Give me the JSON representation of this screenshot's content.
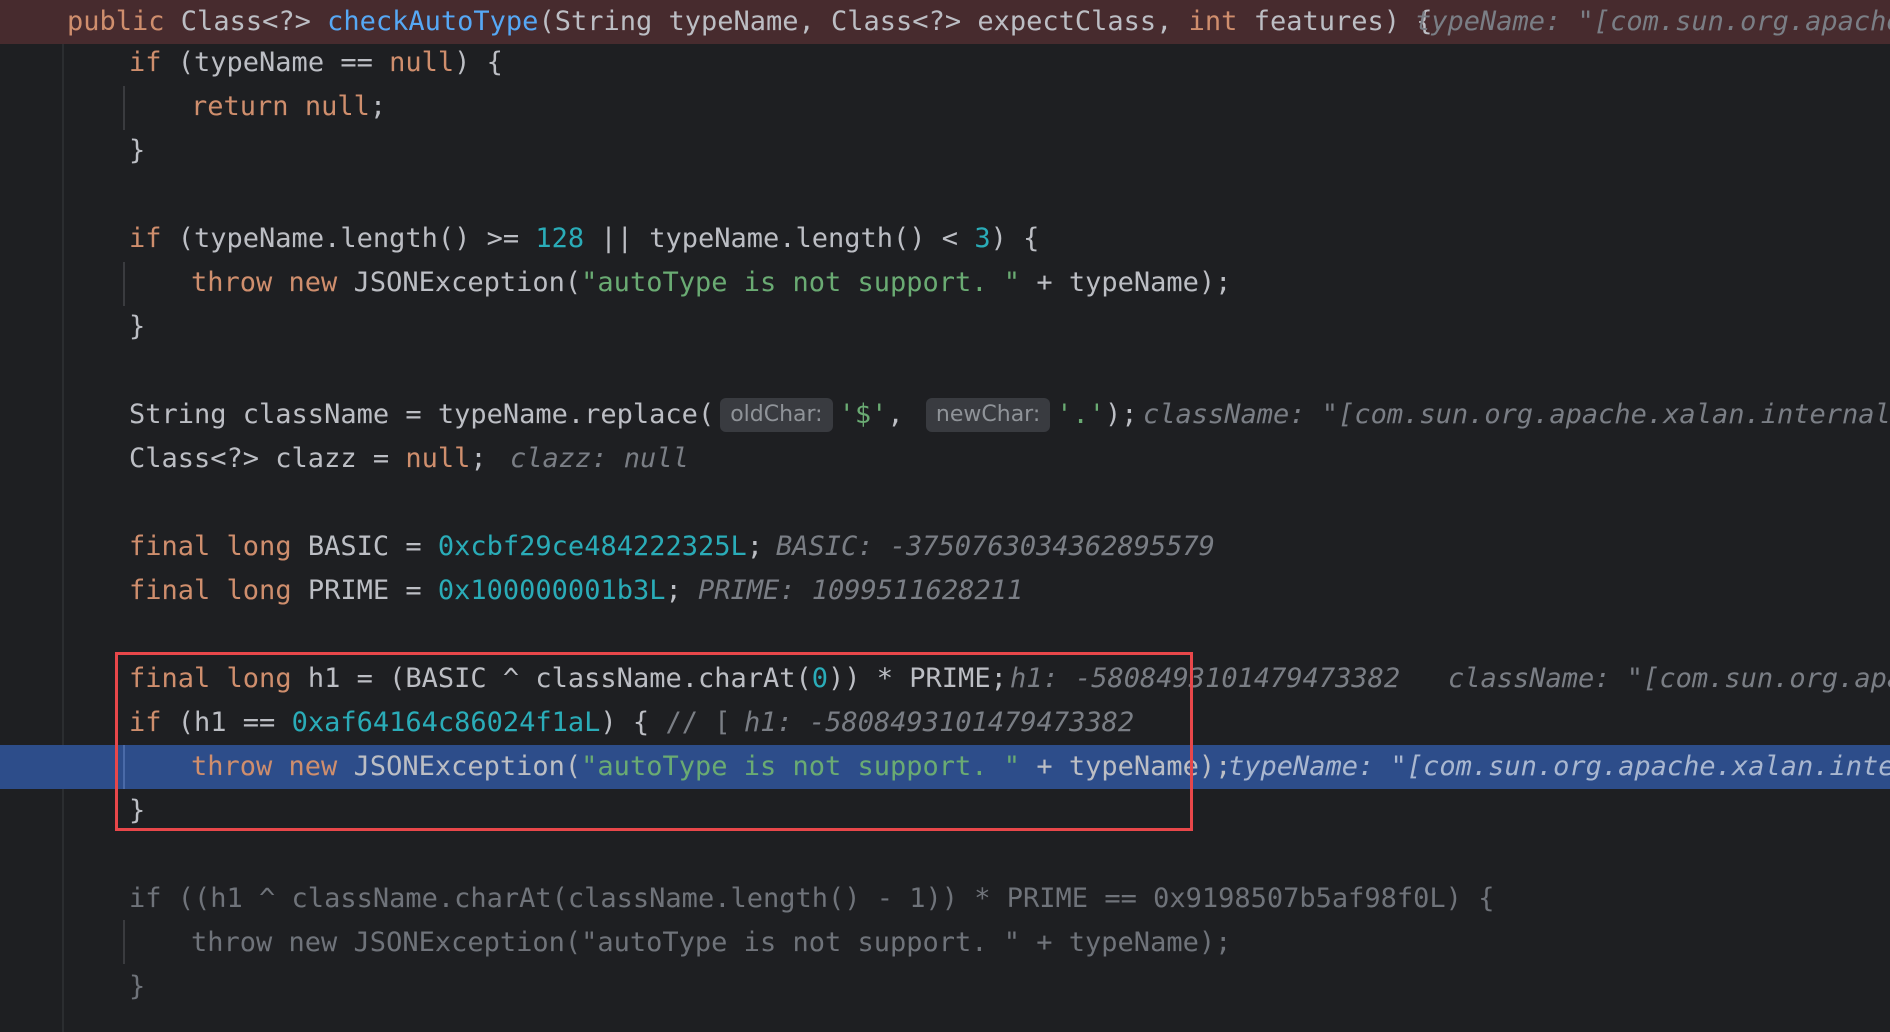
{
  "colors": {
    "background": "#1e1f22",
    "execution_line": "#472b2e",
    "current_line": "#2d4d8a",
    "annotation_box": "#e8474a",
    "keyword": "#cf8e6d",
    "function": "#56a8f5",
    "number": "#2aacb8",
    "string": "#6aab73"
  },
  "code": {
    "l1": {
      "kw1": "public",
      "t1": " Class<?> ",
      "fn": "checkAutoType",
      "t2": "(String typeName, Class<?> expectClass, ",
      "kw2": "int",
      "t3": " features) {",
      "hint": "typeName: \"[com.sun.org.apache"
    },
    "l2": {
      "kw1": "if",
      "t1": " (typeName == ",
      "kw2": "null",
      "t2": ") {"
    },
    "l3": {
      "kw1": "return",
      "t1": " ",
      "kw2": "null",
      "t2": ";"
    },
    "l4": {
      "t1": "}"
    },
    "l5": {
      "kw1": "if",
      "t1": " (typeName.length() >= ",
      "n1": "128",
      "t2": " || typeName.length() < ",
      "n2": "3",
      "t3": ") {"
    },
    "l6": {
      "kw1": "throw",
      "t1": " ",
      "kw2": "new",
      "t2": " JSONException(",
      "s1": "\"autoType is not support. \"",
      "t3": " + typeName);"
    },
    "l7": {
      "t1": "}"
    },
    "l8": {
      "t1": "String className = typeName.replace(",
      "ph1": "oldChar:",
      "s1": "'$'",
      "t2": ",",
      "ph2": "newChar:",
      "s2": "'.'",
      "t3": ");",
      "hint": "className: \"[com.sun.org.apache.xalan.internal.x"
    },
    "l9": {
      "t1": "Class<?> clazz = ",
      "kw1": "null",
      "t2": ";",
      "hint": "clazz: null"
    },
    "l10": {
      "kw1": "final",
      "t1": " ",
      "kw2": "long",
      "t2": " BASIC = ",
      "n1": "0xcbf29ce484222325L",
      "t3": ";",
      "hint": "BASIC: -3750763034362895579"
    },
    "l11": {
      "kw1": "final",
      "t1": " ",
      "kw2": "long",
      "t2": " PRIME = ",
      "n1": "0x100000001b3L",
      "t3": ";",
      "hint": "PRIME: 1099511628211"
    },
    "l12": {
      "kw1": "final",
      "t1": " ",
      "kw2": "long",
      "t2": " h1 = (BASIC ^ className.charAt(",
      "n1": "0",
      "t3": ")) * PRIME;",
      "hint1": "h1: -5808493101479473382",
      "hint2": "className: \"[com.sun.org.apac"
    },
    "l13": {
      "kw1": "if",
      "t1": " (h1 == ",
      "n1": "0xaf64164c86024f1aL",
      "t2": ") { ",
      "c1": "// [",
      "hint": "h1: -5808493101479473382"
    },
    "l14": {
      "kw1": "throw",
      "t1": " ",
      "kw2": "new",
      "t2": " JSONException(",
      "s1": "\"autoType is not support. \"",
      "t3": " + typeName);",
      "hint": "typeName: \"[com.sun.org.apache.xalan.intern"
    },
    "l15": {
      "t1": "}"
    },
    "l16": {
      "t1": "if ((h1 ^ className.charAt(className.length() - 1)) * PRIME == 0x9198507b5af98f0L) {"
    },
    "l17": {
      "t1": "throw new JSONException(\"autoType is not support. \" + typeName);"
    },
    "l18": {
      "t1": "}"
    }
  }
}
